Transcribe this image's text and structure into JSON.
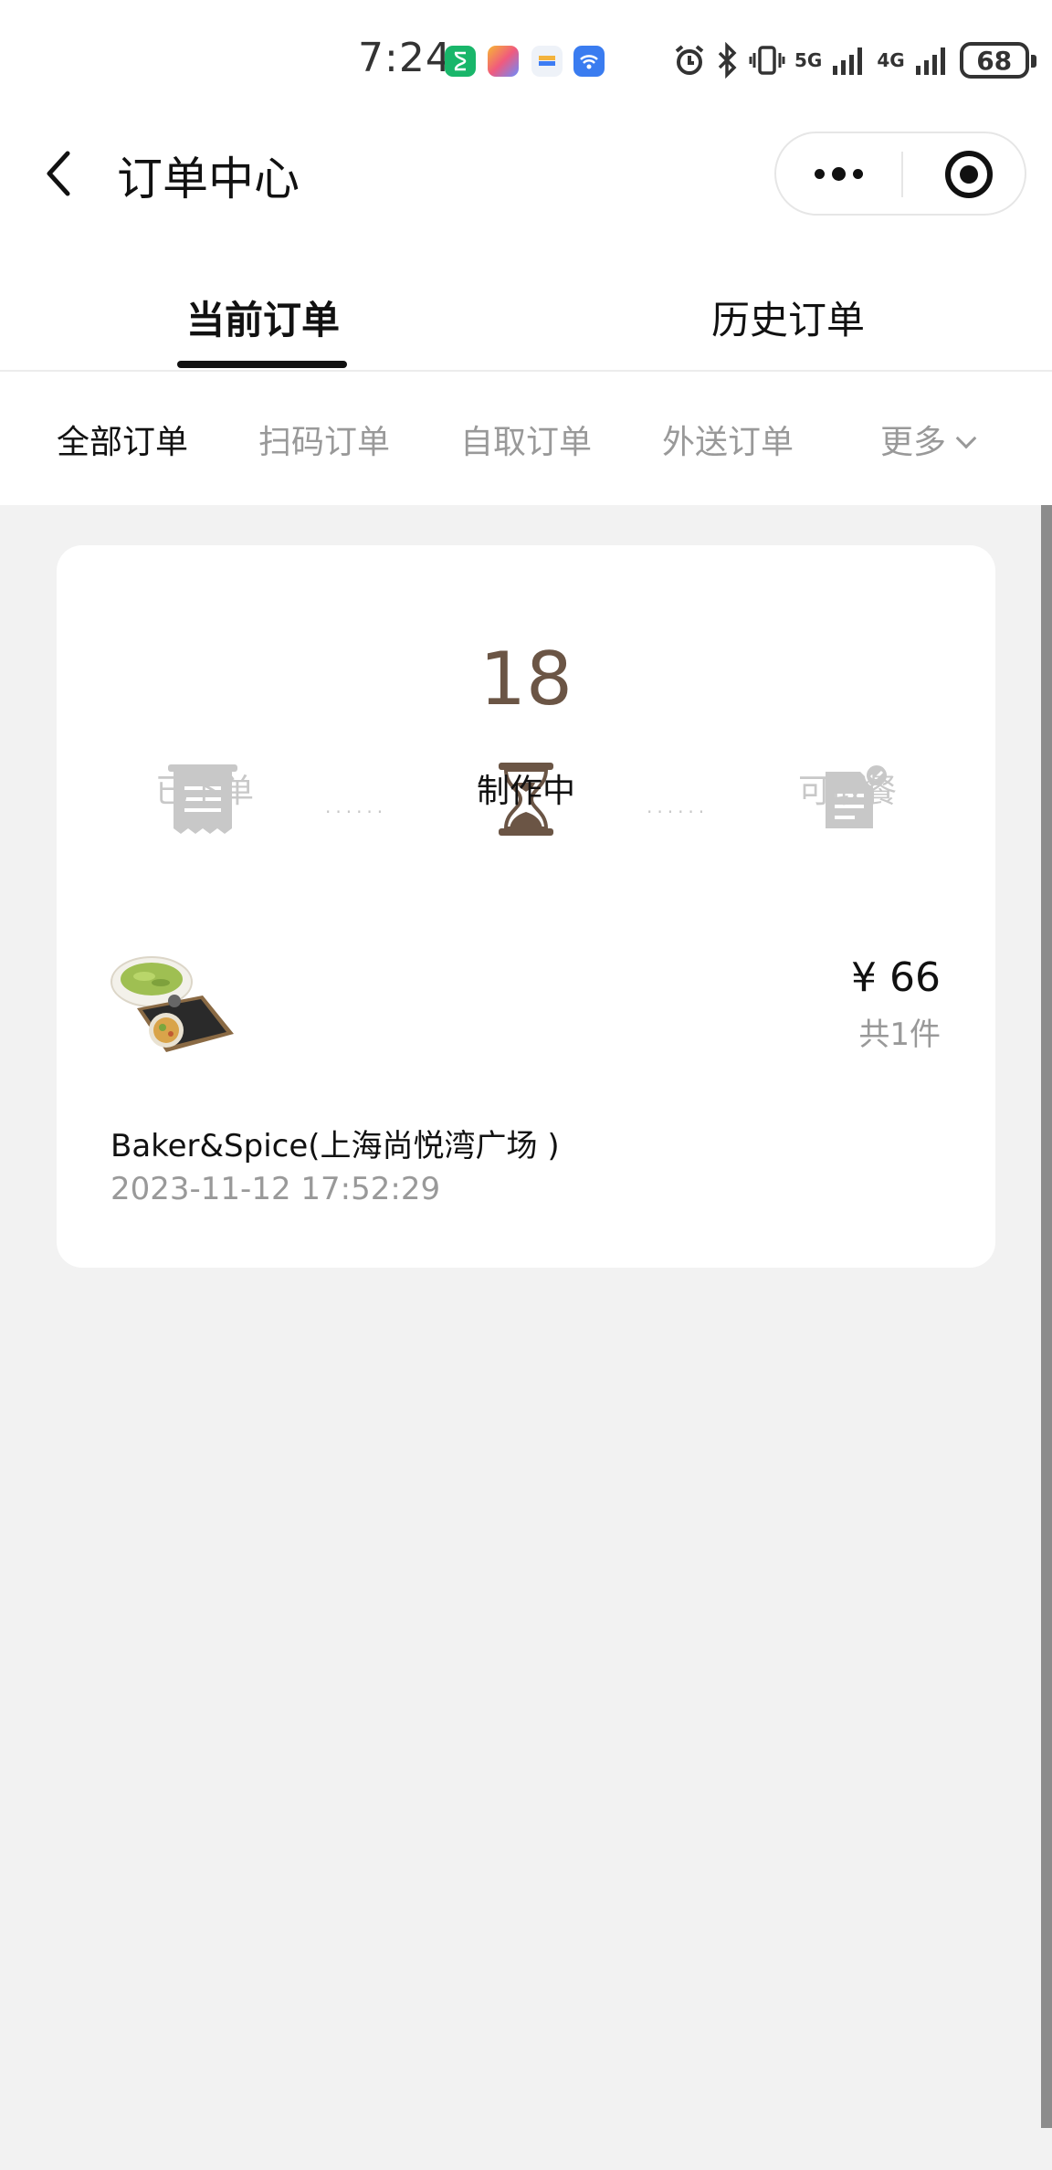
{
  "status_bar": {
    "time": "7:24",
    "battery": "68",
    "net_5g": "5G",
    "net_4g": "4G",
    "icons": [
      "hourglass-app-icon",
      "colorful-app-icon",
      "card-app-icon",
      "wifi-app-icon",
      "alarm-icon",
      "bluetooth-icon",
      "vibrate-icon",
      "signal-5g-icon",
      "signal-4g-icon",
      "battery-icon"
    ]
  },
  "header": {
    "title": "订单中心"
  },
  "tabs": [
    {
      "label": "当前订单",
      "active": true
    },
    {
      "label": "历史订单",
      "active": false
    }
  ],
  "filters": [
    {
      "label": "全部订单",
      "active": true
    },
    {
      "label": "扫码订单",
      "active": false
    },
    {
      "label": "自取订单",
      "active": false
    },
    {
      "label": "外送订单",
      "active": false
    },
    {
      "label": "更多",
      "active": false
    }
  ],
  "order": {
    "pickup_number": "18",
    "steps": [
      {
        "label": "已下单",
        "active": false,
        "icon": "receipt-icon"
      },
      {
        "label": "制作中",
        "active": true,
        "icon": "hourglass-icon"
      },
      {
        "label": "可取餐",
        "active": false,
        "icon": "document-check-icon"
      }
    ],
    "step_dots": "......",
    "price": "¥ 66",
    "quantity": "共1件",
    "store": "Baker&Spice(上海尚悦湾广场 )",
    "time": "2023-11-12 17:52:29"
  },
  "colors": {
    "accent_brown": "#6b5545",
    "inactive_gray": "#c8c8c8",
    "background": "#f2f2f2"
  }
}
